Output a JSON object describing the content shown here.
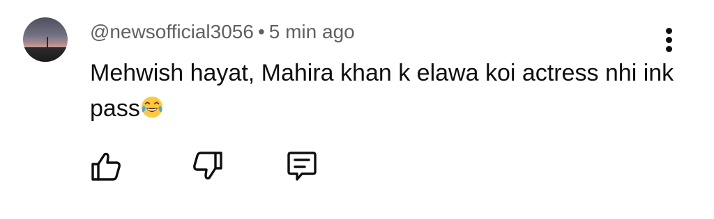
{
  "comment": {
    "author": "@newsofficial3056",
    "separator": "•",
    "timestamp": "5 min ago",
    "text": "Mehwish hayat, Mahira khan k elawa koi actress nhi ink pass",
    "emoji_icon": "face-with-tears-of-joy-icon"
  },
  "actions": {
    "like_icon": "thumbs-up-icon",
    "dislike_icon": "thumbs-down-icon",
    "reply_icon": "comment-bubble-icon"
  },
  "menu": {
    "icon": "more-vertical-icon"
  },
  "colors": {
    "text": "#0f0f0f",
    "meta": "#606060",
    "background": "#ffffff"
  }
}
